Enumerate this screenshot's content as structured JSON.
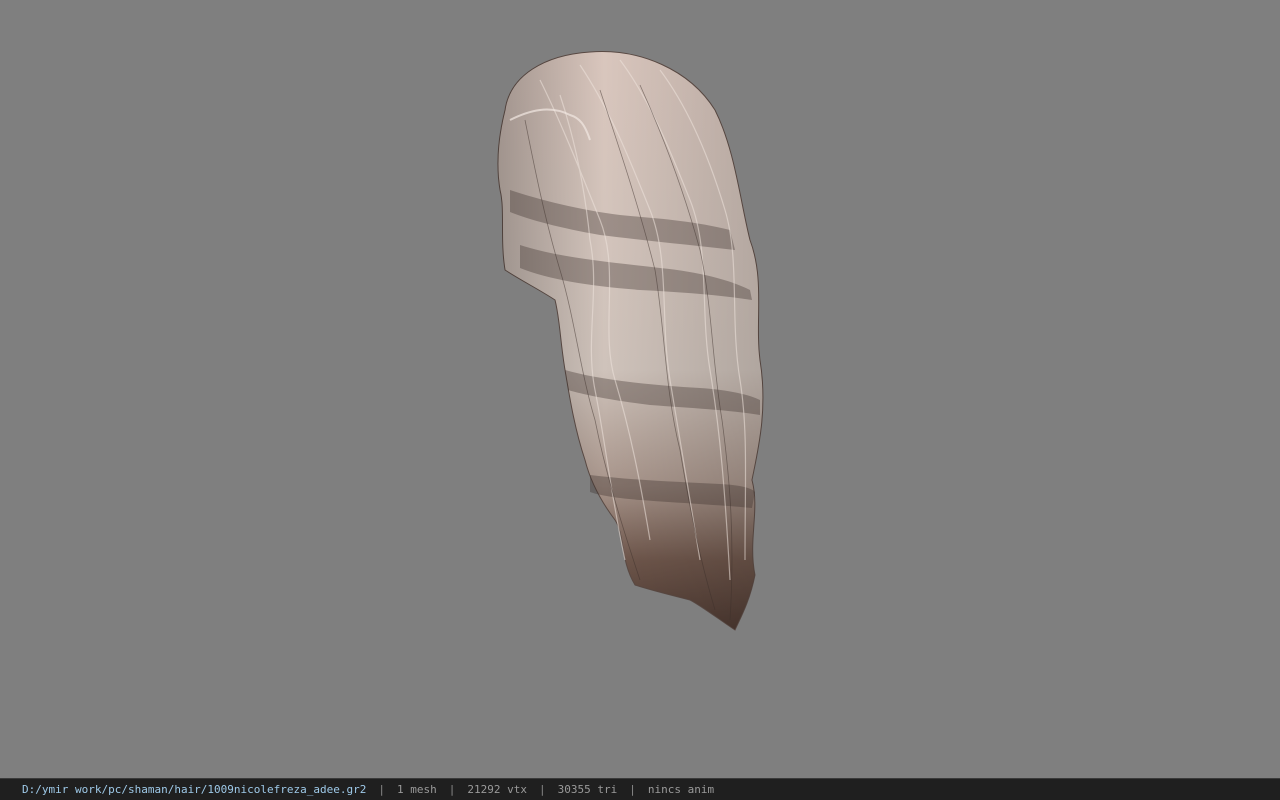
{
  "viewport": {
    "background_color": "#7f7f7f",
    "model": {
      "name": "hair-mesh",
      "base_color": "#d8cbc3",
      "tip_color": "#6a5247"
    }
  },
  "statusbar": {
    "path": "D:/ymir work/pc/shaman/hair/1009nicolefreza_adee.gr2",
    "separator": "|",
    "mesh_count": "1 mesh",
    "vertex_count": "21292 vtx",
    "triangle_count": "30355 tri",
    "anim_status": "nincs anim"
  }
}
